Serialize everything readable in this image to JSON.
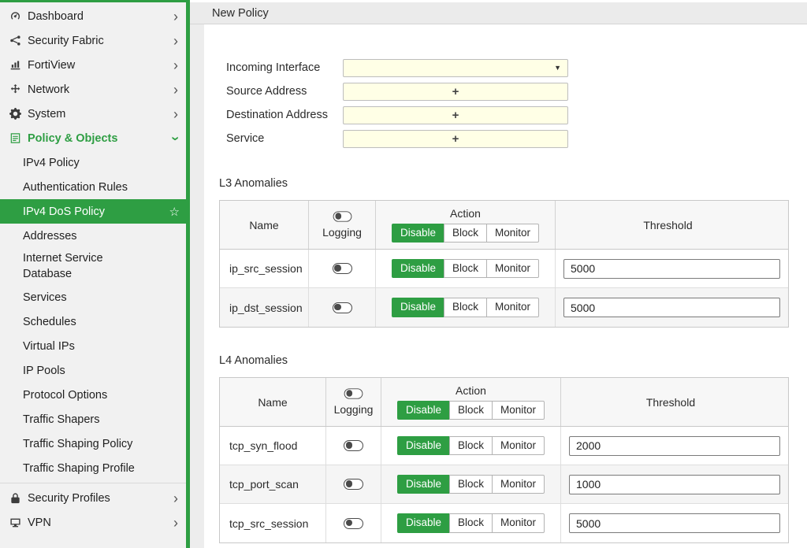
{
  "colors": {
    "accent": "#2e9e43",
    "field_bg": "#ffffe6"
  },
  "icons": {
    "chevron_right": "›",
    "caret_down": "▼",
    "plus": "+",
    "star": "☆"
  },
  "header": {
    "title": "New Policy"
  },
  "sidebar": {
    "items_top": [
      {
        "label": "Dashboard"
      },
      {
        "label": "Security Fabric"
      },
      {
        "label": "FortiView"
      },
      {
        "label": "Network"
      },
      {
        "label": "System"
      },
      {
        "label": "Policy & Objects"
      }
    ],
    "policy_subitems": [
      "IPv4 Policy",
      "Authentication Rules",
      "IPv4 DoS Policy",
      "Addresses",
      "Internet Service Database",
      "Services",
      "Schedules",
      "Virtual IPs",
      "IP Pools",
      "Protocol Options",
      "Traffic Shapers",
      "Traffic Shaping Policy",
      "Traffic Shaping Profile"
    ],
    "active_item": "IPv4 DoS Policy",
    "items_bottom": [
      {
        "label": "Security Profiles"
      },
      {
        "label": "VPN"
      }
    ]
  },
  "form": {
    "fields": [
      {
        "label": "Incoming Interface",
        "value": "",
        "control": "dropdown"
      },
      {
        "label": "Source Address",
        "control": "add"
      },
      {
        "label": "Destination Address",
        "control": "add"
      },
      {
        "label": "Service",
        "control": "add"
      }
    ]
  },
  "tables": {
    "columns": {
      "name": "Name",
      "logging": "Logging",
      "action": "Action",
      "threshold": "Threshold"
    },
    "action_options": [
      "Disable",
      "Block",
      "Monitor"
    ],
    "sections": [
      {
        "title": "L3 Anomalies",
        "rows": [
          {
            "name": "ip_src_session",
            "logging": "off",
            "action": "Disable",
            "threshold": "5000"
          },
          {
            "name": "ip_dst_session",
            "logging": "off",
            "action": "Disable",
            "threshold": "5000"
          }
        ]
      },
      {
        "title": "L4 Anomalies",
        "rows": [
          {
            "name": "tcp_syn_flood",
            "logging": "off",
            "action": "Disable",
            "threshold": "2000"
          },
          {
            "name": "tcp_port_scan",
            "logging": "off",
            "action": "Disable",
            "threshold": "1000"
          },
          {
            "name": "tcp_src_session",
            "logging": "off",
            "action": "Disable",
            "threshold": "5000"
          }
        ]
      }
    ]
  }
}
